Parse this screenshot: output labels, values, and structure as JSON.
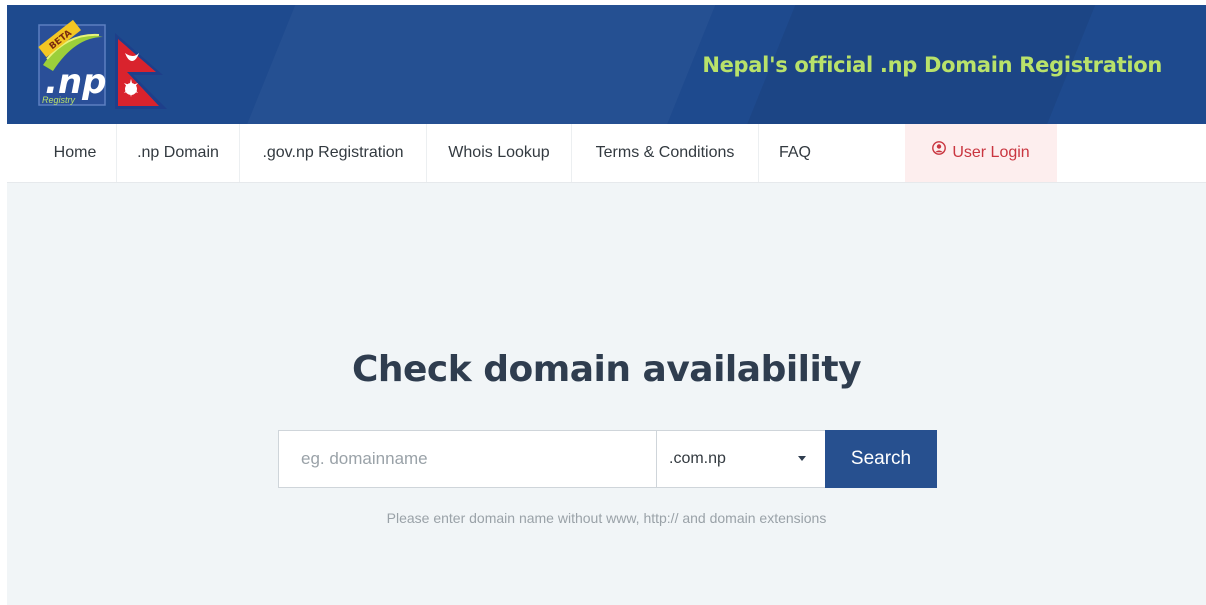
{
  "header": {
    "logo_text": ".np",
    "logo_sub": "Registry",
    "logo_badge": "BETA",
    "tagline": "Nepal's official .np Domain Registration"
  },
  "nav": {
    "items": [
      {
        "label": "Home"
      },
      {
        "label": ".np Domain"
      },
      {
        "label": ".gov.np Registration"
      },
      {
        "label": "Whois Lookup"
      },
      {
        "label": "Terms & Conditions"
      },
      {
        "label": "FAQ"
      }
    ],
    "login_label": "User Login"
  },
  "main": {
    "headline": "Check domain availability",
    "search": {
      "placeholder": "eg. domainname",
      "value": "",
      "extension": ".com.np",
      "button_label": "Search"
    },
    "hint": "Please enter domain name without www, http:// and domain extensions"
  },
  "colors": {
    "header_bg": "#1e4a8e",
    "tagline": "#b9e26a",
    "login_text": "#c9353f",
    "login_bg": "#fdeeee",
    "search_button": "#27508f"
  },
  "icons": {
    "login": "user-circle-icon",
    "select": "chevron-down-icon",
    "flag": "nepal-flag-icon"
  }
}
